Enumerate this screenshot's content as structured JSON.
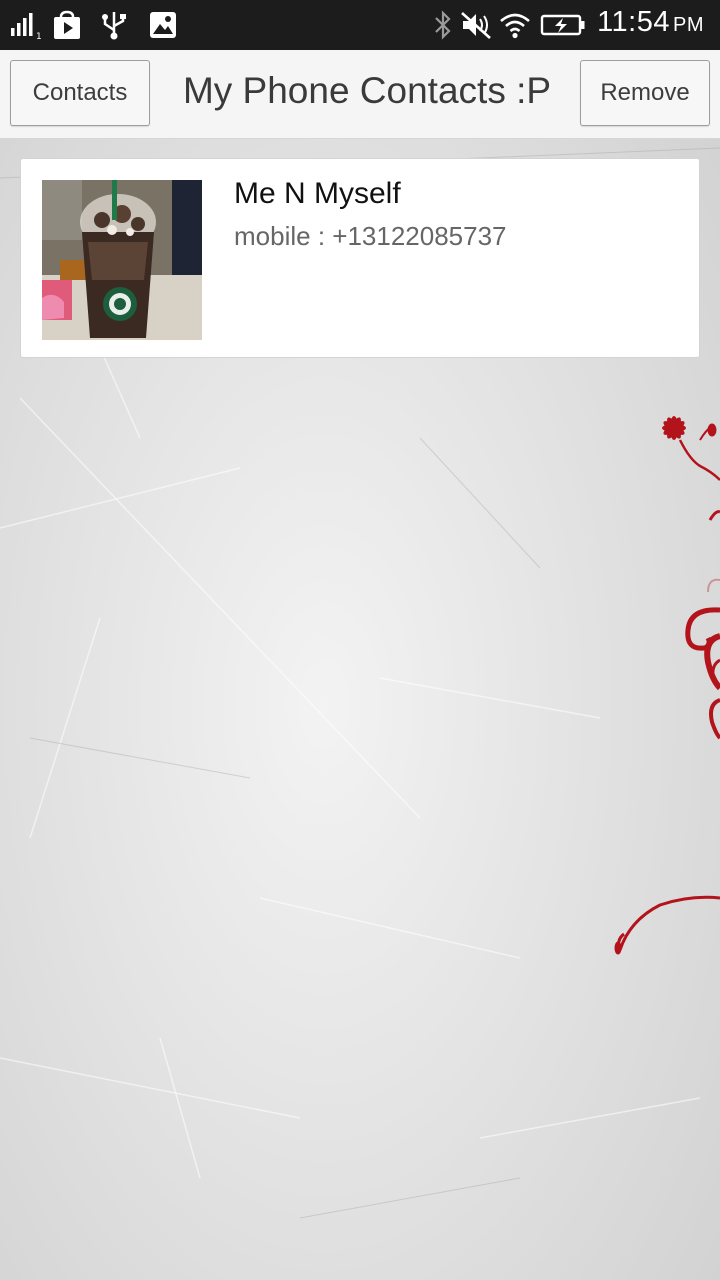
{
  "status_bar": {
    "time": "11:54",
    "ampm": "PM",
    "icons": [
      "signal-icon",
      "play-store-icon",
      "usb-icon",
      "gallery-icon",
      "bluetooth-icon",
      "mute-icon",
      "wifi-icon",
      "battery-charging-icon"
    ]
  },
  "action_bar": {
    "contacts_label": "Contacts",
    "title": "My Phone Contacts :P",
    "remove_label": "Remove"
  },
  "contacts": [
    {
      "name": "Me N Myself",
      "phone": "mobile : +13122085737"
    }
  ],
  "colors": {
    "status_bar": "#1c1c1c",
    "action_bar": "#f5f5f5",
    "floral_accent": "#b3131b"
  }
}
